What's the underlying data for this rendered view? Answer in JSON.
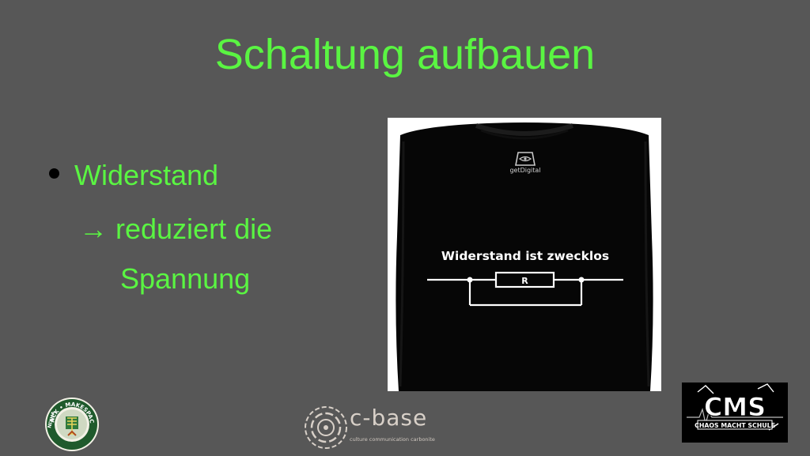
{
  "slide": {
    "title": "Schaltung aufbauen",
    "bullet": "Widerstand",
    "line2": "→ reduziert die",
    "line3": "Spannung"
  },
  "tshirt": {
    "brand_label": "getDigital",
    "slogan": "Widerstand ist zwecklos",
    "resistor_label": "R"
  },
  "logos": {
    "hack_ring_text": "HACK • MAKESPACE",
    "hack_side_text": "NIXHA",
    "cbase_name": "c-base",
    "cbase_tagline": "culture communication carbonite",
    "cms_big": "CMS",
    "cms_text": "CHAOS MACHT SCHULE"
  },
  "colors": {
    "background": "#575757",
    "accent_green": "#5af542"
  }
}
